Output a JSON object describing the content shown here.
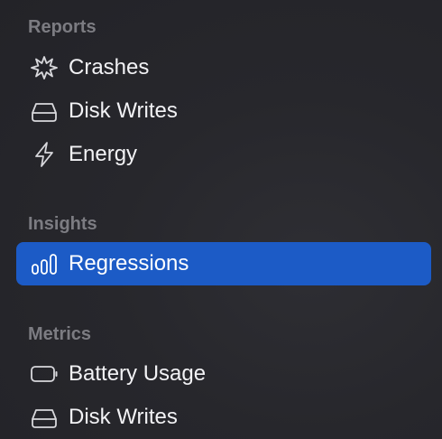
{
  "sidebar": {
    "reports": {
      "header": "Reports",
      "items": [
        {
          "label": "Crashes",
          "icon": "crash-icon"
        },
        {
          "label": "Disk Writes",
          "icon": "disk-icon"
        },
        {
          "label": "Energy",
          "icon": "energy-icon"
        }
      ]
    },
    "insights": {
      "header": "Insights",
      "items": [
        {
          "label": "Regressions",
          "icon": "regressions-icon",
          "selected": true
        }
      ]
    },
    "metrics": {
      "header": "Metrics",
      "items": [
        {
          "label": "Battery Usage",
          "icon": "battery-icon"
        },
        {
          "label": "Disk Writes",
          "icon": "disk-icon"
        }
      ]
    }
  },
  "colors": {
    "background": "#27272c",
    "selection": "#1c5bc6",
    "section_header": "#7c7c82",
    "text": "#f2f2f5"
  }
}
